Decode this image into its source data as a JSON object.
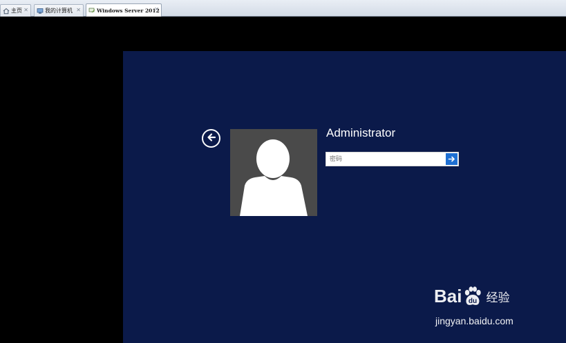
{
  "tabs": [
    {
      "label": "主页",
      "icon": "home-icon",
      "closable": true,
      "active": false
    },
    {
      "label": "我的计算机",
      "icon": "computer-icon",
      "closable": true,
      "active": false
    },
    {
      "label": "Windows Server 2012",
      "icon": "vm-icon",
      "closable": true,
      "active": true
    }
  ],
  "tab_close_glyph": "✕",
  "login": {
    "username": "Administrator",
    "password_placeholder": "密码",
    "password_value": "",
    "back_icon": "back-arrow-icon",
    "avatar_icon": "user-avatar-icon",
    "submit_icon": "arrow-right-icon"
  },
  "watermark": {
    "brand_left": "Bai",
    "brand_right": "经验",
    "url": "jingyan.baidu.com"
  },
  "colors": {
    "vm_background": "#0b1a4a",
    "avatar_background": "#4a4a4a",
    "submit_button": "#1e6fd3",
    "outside_area": "#000000"
  }
}
